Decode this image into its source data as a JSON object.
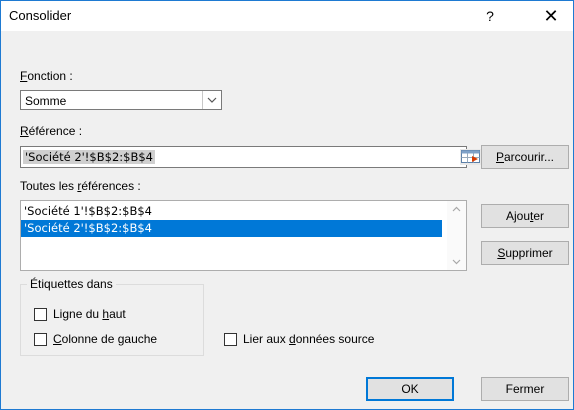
{
  "dialog": {
    "title": "Consolider",
    "help_label": "?",
    "close_label": "✕"
  },
  "function": {
    "label_u": "F",
    "label_rest": "onction :",
    "value": "Somme"
  },
  "reference": {
    "label_u": "R",
    "label_rest": "éférence :",
    "value": "'Société 2'!$B$2:$B$4",
    "browse_pre": "",
    "browse_u": "P",
    "browse_post": "arcourir..."
  },
  "all_refs": {
    "label_pre": "Toutes les ",
    "label_u": "r",
    "label_post": "éférences :",
    "items": [
      {
        "text": "'Société 1'!$B$2:$B$4",
        "selected": false
      },
      {
        "text": "'Société 2'!$B$2:$B$4",
        "selected": true
      }
    ]
  },
  "buttons": {
    "add_pre": "Ajou",
    "add_u": "t",
    "add_post": "er",
    "delete_u": "S",
    "delete_post": "upprimer",
    "ok": "OK",
    "close": "Fermer"
  },
  "labels_group": {
    "title": "Étiquettes dans",
    "top_row_pre": "Ligne du ",
    "top_row_u": "h",
    "top_row_post": "aut",
    "left_col_u": "C",
    "left_col_post": "olonne de gauche",
    "top_row_checked": false,
    "left_col_checked": false
  },
  "link": {
    "pre": "Lier aux ",
    "u": "d",
    "post": "onnées source",
    "checked": false
  },
  "icons": {
    "dropdown": "chevron-down-icon",
    "collapse_ref": "range-select-icon",
    "scroll_up": "chevron-up-icon",
    "scroll_down": "chevron-down-icon"
  },
  "colors": {
    "accent": "#0078d7",
    "window_border": "#1e7ad2",
    "dialog_bg": "#f0f0f0"
  }
}
